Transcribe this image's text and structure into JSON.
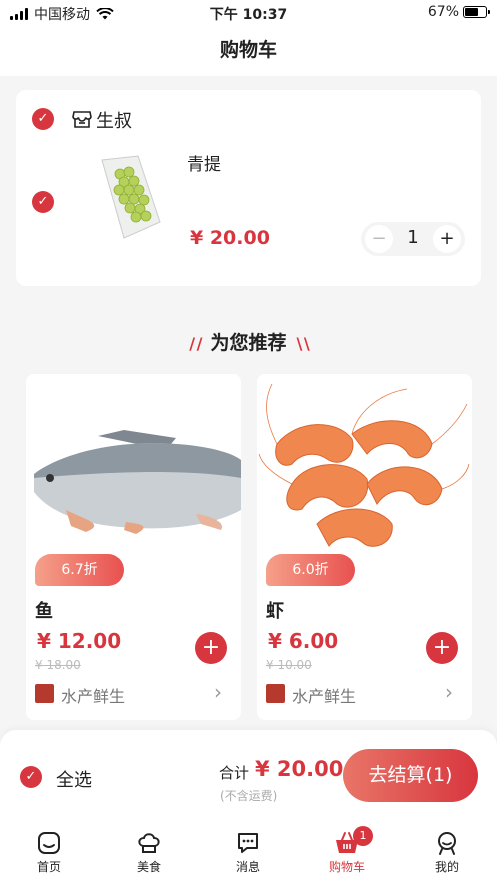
{
  "status_bar": {
    "carrier": "中国移动",
    "time": "下午 10:37",
    "battery": "67%",
    "battery_level": 0.67
  },
  "header": {
    "title": "购物车"
  },
  "cart": {
    "shop_name": "生叔",
    "items": [
      {
        "name": "青提",
        "price": "¥ 20.00",
        "quantity": "1"
      }
    ],
    "stepper": {
      "minus": "−",
      "plus": "+"
    }
  },
  "recommend": {
    "title": "为您推荐",
    "products": [
      {
        "discount": "6.7折",
        "name": "鱼",
        "price": "¥ 12.00",
        "original_price": "¥ 18.00",
        "category": "水产鲜生"
      },
      {
        "discount": "6.0折",
        "name": "虾",
        "price": "¥ 6.00",
        "original_price": "¥ 10.00",
        "category": "水产鲜生"
      }
    ]
  },
  "footer": {
    "select_all": "全选",
    "total_label": "合计",
    "total_value": "¥ 20.00",
    "shipping_note": "(不含运费)",
    "checkout": "去结算(1)"
  },
  "tabbar": {
    "tabs": [
      {
        "label": "首页",
        "icon": "home-icon"
      },
      {
        "label": "美食",
        "icon": "chef-hat-icon"
      },
      {
        "label": "消息",
        "icon": "message-icon"
      },
      {
        "label": "购物车",
        "icon": "basket-icon",
        "badge": "1"
      },
      {
        "label": "我的",
        "icon": "user-icon"
      }
    ],
    "active": "购物车"
  },
  "colors": {
    "accent": "#d8363f",
    "background": "#f5f5f5"
  }
}
